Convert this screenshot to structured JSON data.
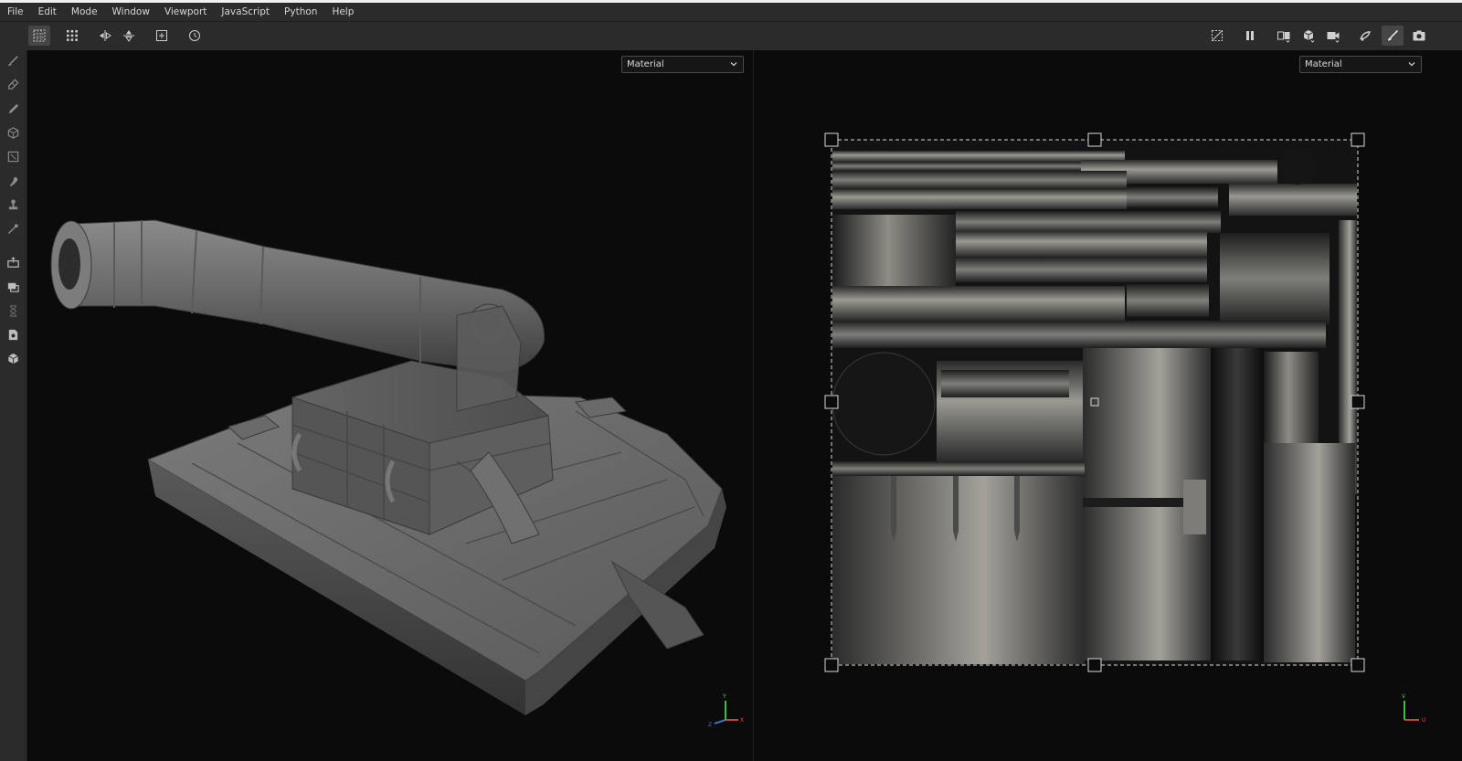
{
  "menu": [
    "File",
    "Edit",
    "Mode",
    "Window",
    "Viewport",
    "JavaScript",
    "Python",
    "Help"
  ],
  "toolbar_left": [
    {
      "icon": "grid-snap-icon",
      "active": true
    },
    {
      "icon": "grid-dots-icon",
      "active": false
    },
    {
      "icon": "mirror-x-icon",
      "active": false
    },
    {
      "icon": "mirror-y-icon",
      "active": false
    },
    {
      "icon": "add-layer-icon",
      "active": false
    },
    {
      "icon": "history-icon",
      "active": false
    }
  ],
  "toolbar_right": [
    {
      "icon": "hide-uv-icon",
      "active": false
    },
    {
      "icon": "pause-icon",
      "active": false
    },
    {
      "icon": "split-view-icon",
      "active": false
    },
    {
      "icon": "cube-view-icon",
      "active": false
    },
    {
      "icon": "camera-icon",
      "active": false
    },
    {
      "icon": "lighting-icon",
      "active": false
    },
    {
      "icon": "paint-mode-icon",
      "active": true
    },
    {
      "icon": "screenshot-icon",
      "active": false
    }
  ],
  "left_tools": [
    "brush-icon",
    "eraser-icon",
    "projection-icon",
    "geometry-fill-icon",
    "polygon-fill-icon",
    "smudge-icon",
    "clone-stamp-icon",
    "color-picker-icon",
    "bake-icon",
    "texture-set-icon",
    "hourglass-icon",
    "document-icon",
    "cube-export-icon"
  ],
  "viewport3d": {
    "channel_select": "Material",
    "axis": {
      "x": "X",
      "y": "Y",
      "z": "Z"
    }
  },
  "viewport2d": {
    "channel_select": "Material",
    "axis": {
      "u": "U",
      "v": "V"
    }
  }
}
